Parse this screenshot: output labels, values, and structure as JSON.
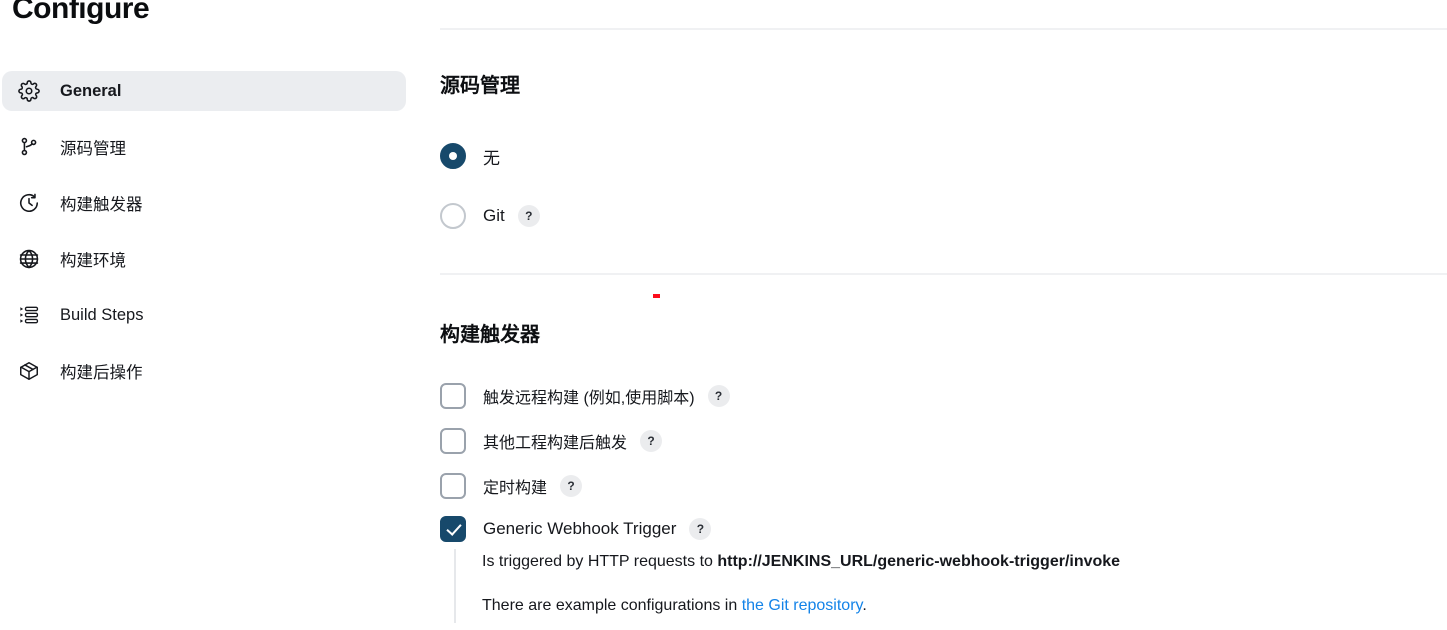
{
  "sidebar": {
    "title": "Configure",
    "items": [
      {
        "label": "General",
        "icon": "gear-icon",
        "active": true
      },
      {
        "label": "源码管理",
        "icon": "git-branch-icon",
        "active": false
      },
      {
        "label": "构建触发器",
        "icon": "clock-icon",
        "active": false
      },
      {
        "label": "构建环境",
        "icon": "globe-icon",
        "active": false
      },
      {
        "label": "Build Steps",
        "icon": "list-steps-icon",
        "active": false
      },
      {
        "label": "构建后操作",
        "icon": "package-icon",
        "active": false
      }
    ]
  },
  "main": {
    "scm": {
      "heading": "源码管理",
      "options": [
        {
          "label": "无",
          "selected": true,
          "help": ""
        },
        {
          "label": "Git",
          "selected": false,
          "help": "?"
        }
      ]
    },
    "triggers": {
      "heading": "构建触发器",
      "options": [
        {
          "label": "触发远程构建 (例如,使用脚本)",
          "checked": false,
          "help": "?"
        },
        {
          "label": "其他工程构建后触发",
          "checked": false,
          "help": "?"
        },
        {
          "label": "定时构建",
          "checked": false,
          "help": "?"
        },
        {
          "label": "Generic Webhook Trigger",
          "checked": true,
          "help": "?"
        }
      ],
      "webhook_info": {
        "line1_prefix": "Is triggered by HTTP requests to ",
        "line1_url": "http://JENKINS_URL/generic-webhook-trigger/invoke",
        "line2_prefix": "There are example configurations in ",
        "line2_link": "the Git repository",
        "line2_suffix": "."
      }
    }
  },
  "colors": {
    "accent": "#17496b",
    "link": "#1383e8",
    "active_bg": "#ebedf0",
    "divider": "#f0f1f3",
    "marker": "#fc0d1b"
  }
}
